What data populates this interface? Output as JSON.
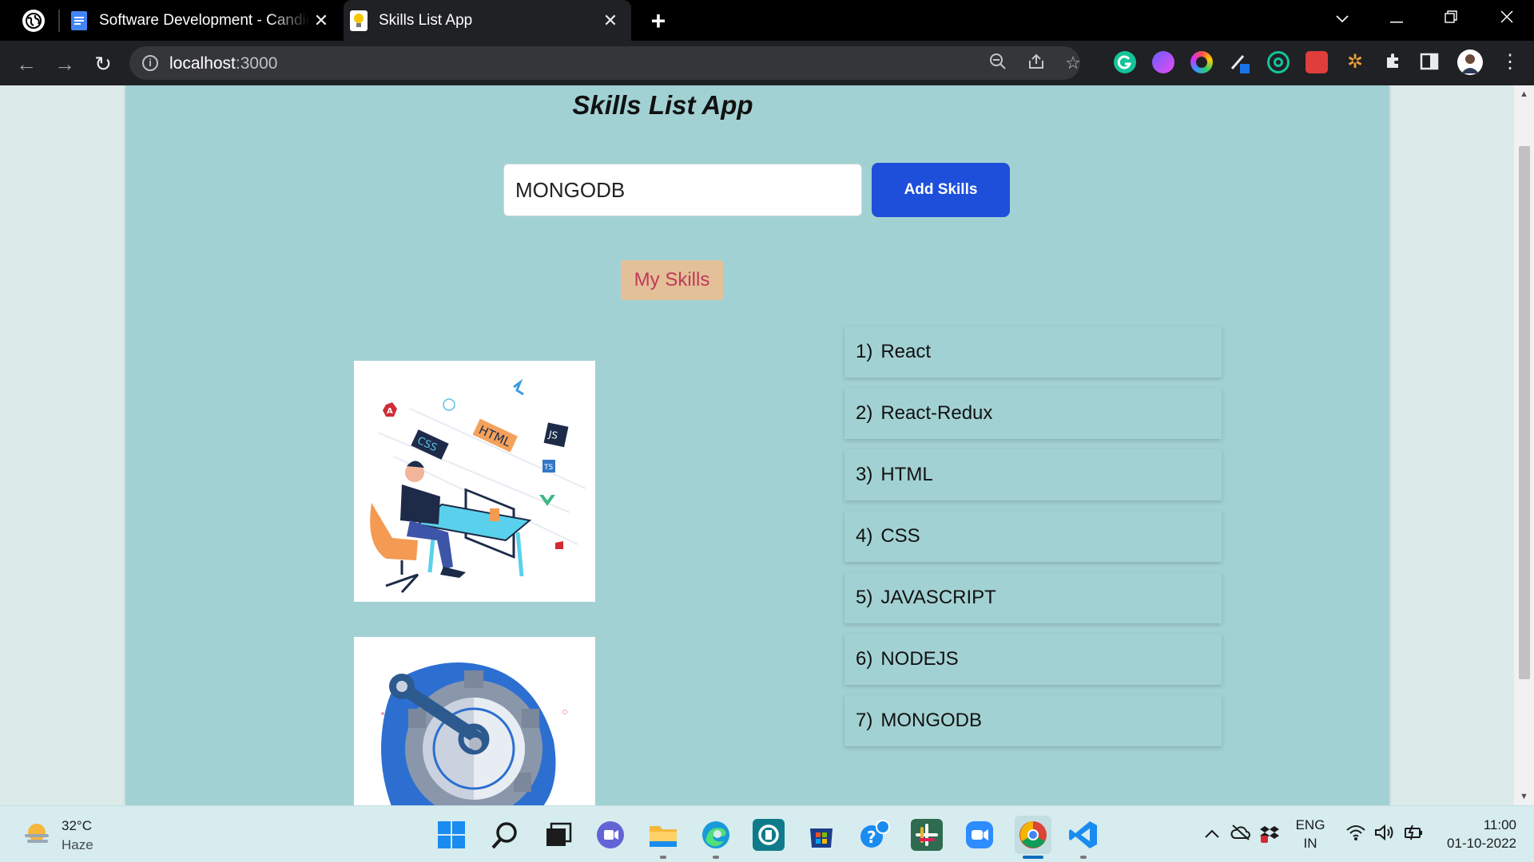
{
  "browser": {
    "tabs": [
      {
        "title": "Software Development - Candidate",
        "active": false
      },
      {
        "title": "Skills List App",
        "active": true
      }
    ],
    "address": {
      "host": "localhost",
      "port": ":3000"
    }
  },
  "app": {
    "title": "Skills List App",
    "input_value": "MONGODB",
    "add_button_label": "Add Skills",
    "my_skills_label": "My Skills",
    "skills": [
      {
        "num": "1)",
        "name": "React"
      },
      {
        "num": "2)",
        "name": "React-Redux"
      },
      {
        "num": "3)",
        "name": "HTML"
      },
      {
        "num": "4)",
        "name": "CSS"
      },
      {
        "num": "5)",
        "name": "JAVASCRIPT"
      },
      {
        "num": "6)",
        "name": "NODEJS"
      },
      {
        "num": "7)",
        "name": "MONGODB"
      }
    ],
    "illustration_labels": [
      "HTML",
      "CSS",
      "JS",
      "TS"
    ]
  },
  "taskbar": {
    "weather_temp": "32°C",
    "weather_desc": "Haze",
    "lang_line1": "ENG",
    "lang_line2": "IN",
    "time": "11:00",
    "date": "01-10-2022"
  },
  "colors": {
    "app_bg": "#a2d1d3",
    "add_button": "#1e4fdb",
    "my_skills_bg": "#e4c098",
    "my_skills_text": "#bf3a5a"
  }
}
